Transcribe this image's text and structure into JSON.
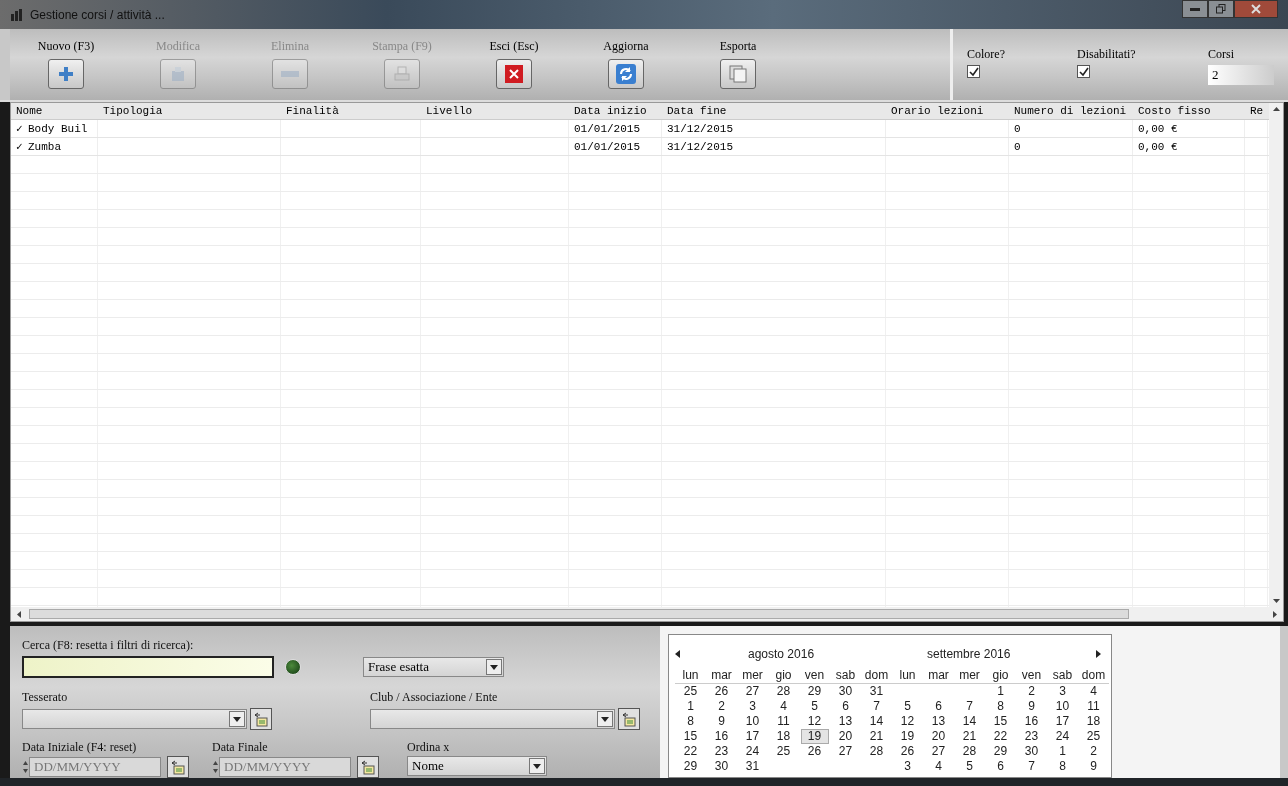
{
  "window": {
    "title": "Gestione corsi / attività ..."
  },
  "toolbar": [
    {
      "label": "Nuovo (F3)",
      "kind": "plus",
      "disabled": false
    },
    {
      "label": "Modifica",
      "kind": "document",
      "disabled": true
    },
    {
      "label": "Elimina",
      "kind": "minus",
      "disabled": true
    },
    {
      "label": "Stampa (F9)",
      "kind": "printer",
      "disabled": true
    },
    {
      "label": "Esci (Esc)",
      "kind": "exit",
      "disabled": false
    },
    {
      "label": "Aggiorna",
      "kind": "refresh",
      "disabled": false
    },
    {
      "label": "Esporta",
      "kind": "copy",
      "disabled": false
    }
  ],
  "options": {
    "color": {
      "label": "Colore?",
      "checked": true
    },
    "disabled": {
      "label": "Disabilitati?",
      "checked": true
    },
    "count": {
      "label": "Corsi",
      "value": "2"
    }
  },
  "table": {
    "columns": [
      "Nome",
      "Tipologia",
      "Finalità",
      "Livello",
      "Data inizio",
      "Data fine",
      "Orario lezioni",
      "Numero di lezioni",
      "Costo fisso",
      "Re"
    ],
    "rows": [
      {
        "checked": true,
        "mark": "✓",
        "name": "Body Buil",
        "start": "01/01/2015",
        "end": "31/12/2015",
        "lessons": "0",
        "cost": "0,00 €"
      },
      {
        "checked": true,
        "mark": "✓",
        "name": "Zumba",
        "start": "01/01/2015",
        "end": "31/12/2015",
        "lessons": "0",
        "cost": "0,00 €"
      }
    ]
  },
  "filters": {
    "search": {
      "label": "Cerca (F8: resetta i filtri di ricerca):"
    },
    "match": {
      "value": "Frase esatta"
    },
    "member": {
      "label": "Tesserato"
    },
    "club": {
      "label": "Club / Associazione / Ente"
    },
    "start_date": {
      "label": "Data Iniziale (F4: reset)",
      "placeholder": "DD/MM/YYYY"
    },
    "end_date": {
      "label": "Data Finale",
      "placeholder": "DD/MM/YYYY"
    },
    "order": {
      "label": "Ordina x",
      "value": "Nome"
    }
  },
  "calendar": {
    "months": [
      {
        "title": "agosto 2016",
        "weekdays": [
          "lun",
          "mar",
          "mer",
          "gio",
          "ven",
          "sab",
          "dom"
        ],
        "weeks": [
          [
            {
              "kind": "day",
              "day": "25",
              "selected": false
            },
            {
              "kind": "day",
              "day": "26",
              "selected": false
            },
            {
              "kind": "day",
              "day": "27",
              "selected": false
            },
            {
              "kind": "day",
              "day": "28",
              "selected": false
            },
            {
              "kind": "day",
              "day": "29",
              "selected": false
            },
            {
              "kind": "day",
              "day": "30",
              "selected": false
            },
            {
              "kind": "day",
              "day": "31",
              "selected": false
            }
          ],
          [
            {
              "kind": "day",
              "day": "1",
              "selected": false
            },
            {
              "kind": "day",
              "day": "2",
              "selected": false
            },
            {
              "kind": "day",
              "day": "3",
              "selected": false
            },
            {
              "kind": "day",
              "day": "4",
              "selected": false
            },
            {
              "kind": "day",
              "day": "5",
              "selected": false
            },
            {
              "kind": "day",
              "day": "6",
              "selected": false
            },
            {
              "kind": "day",
              "day": "7",
              "selected": false
            }
          ],
          [
            {
              "kind": "day",
              "day": "8",
              "selected": false
            },
            {
              "kind": "day",
              "day": "9",
              "selected": false
            },
            {
              "kind": "day",
              "day": "10",
              "selected": false
            },
            {
              "kind": "day",
              "day": "11",
              "selected": false
            },
            {
              "kind": "day",
              "day": "12",
              "selected": false
            },
            {
              "kind": "day",
              "day": "13",
              "selected": false
            },
            {
              "kind": "day",
              "day": "14",
              "selected": false
            }
          ],
          [
            {
              "kind": "day",
              "day": "15",
              "selected": false
            },
            {
              "kind": "day",
              "day": "16",
              "selected": false
            },
            {
              "kind": "day",
              "day": "17",
              "selected": false
            },
            {
              "kind": "day",
              "day": "18",
              "selected": false
            },
            {
              "kind": "day",
              "day": "19",
              "selected": true
            },
            {
              "kind": "day",
              "day": "20",
              "selected": false
            },
            {
              "kind": "day",
              "day": "21",
              "selected": false
            }
          ],
          [
            {
              "kind": "day",
              "day": "22",
              "selected": false
            },
            {
              "kind": "day",
              "day": "23",
              "selected": false
            },
            {
              "kind": "day",
              "day": "24",
              "selected": false
            },
            {
              "kind": "day",
              "day": "25",
              "selected": false
            },
            {
              "kind": "day",
              "day": "26",
              "selected": false
            },
            {
              "kind": "day",
              "day": "27",
              "selected": false
            },
            {
              "kind": "day",
              "day": "28",
              "selected": false
            }
          ],
          [
            {
              "kind": "day",
              "day": "29",
              "selected": false
            },
            {
              "kind": "day",
              "day": "30",
              "selected": false
            },
            {
              "kind": "day",
              "day": "31",
              "selected": false
            },
            {
              "kind": "empty"
            },
            {
              "kind": "empty"
            },
            {
              "kind": "empty"
            },
            {
              "kind": "empty"
            }
          ]
        ]
      },
      {
        "title": "settembre 2016",
        "weekdays": [
          "lun",
          "mar",
          "mer",
          "gio",
          "ven",
          "sab",
          "dom"
        ],
        "weeks": [
          [
            {
              "kind": "empty"
            },
            {
              "kind": "empty"
            },
            {
              "kind": "empty"
            },
            {
              "kind": "day",
              "day": "1",
              "selected": false
            },
            {
              "kind": "day",
              "day": "2",
              "selected": false
            },
            {
              "kind": "day",
              "day": "3",
              "selected": false
            },
            {
              "kind": "day",
              "day": "4",
              "selected": false
            }
          ],
          [
            {
              "kind": "day",
              "day": "5",
              "selected": false
            },
            {
              "kind": "day",
              "day": "6",
              "selected": false
            },
            {
              "kind": "day",
              "day": "7",
              "selected": false
            },
            {
              "kind": "day",
              "day": "8",
              "selected": false
            },
            {
              "kind": "day",
              "day": "9",
              "selected": false
            },
            {
              "kind": "day",
              "day": "10",
              "selected": false
            },
            {
              "kind": "day",
              "day": "11",
              "selected": false
            }
          ],
          [
            {
              "kind": "day",
              "day": "12",
              "selected": false
            },
            {
              "kind": "day",
              "day": "13",
              "selected": false
            },
            {
              "kind": "day",
              "day": "14",
              "selected": false
            },
            {
              "kind": "day",
              "day": "15",
              "selected": false
            },
            {
              "kind": "day",
              "day": "16",
              "selected": false
            },
            {
              "kind": "day",
              "day": "17",
              "selected": false
            },
            {
              "kind": "day",
              "day": "18",
              "selected": false
            }
          ],
          [
            {
              "kind": "day",
              "day": "19",
              "selected": false
            },
            {
              "kind": "day",
              "day": "20",
              "selected": false
            },
            {
              "kind": "day",
              "day": "21",
              "selected": false
            },
            {
              "kind": "day",
              "day": "22",
              "selected": false
            },
            {
              "kind": "day",
              "day": "23",
              "selected": false
            },
            {
              "kind": "day",
              "day": "24",
              "selected": false
            },
            {
              "kind": "day",
              "day": "25",
              "selected": false
            }
          ],
          [
            {
              "kind": "day",
              "day": "26",
              "selected": false
            },
            {
              "kind": "day",
              "day": "27",
              "selected": false
            },
            {
              "kind": "day",
              "day": "28",
              "selected": false
            },
            {
              "kind": "day",
              "day": "29",
              "selected": false
            },
            {
              "kind": "day",
              "day": "30",
              "selected": false
            },
            {
              "kind": "day",
              "day": "1",
              "selected": false
            },
            {
              "kind": "day",
              "day": "2",
              "selected": false
            }
          ],
          [
            {
              "kind": "day",
              "day": "3",
              "selected": false
            },
            {
              "kind": "day",
              "day": "4",
              "selected": false
            },
            {
              "kind": "day",
              "day": "5",
              "selected": false
            },
            {
              "kind": "day",
              "day": "6",
              "selected": false
            },
            {
              "kind": "day",
              "day": "7",
              "selected": false
            },
            {
              "kind": "day",
              "day": "8",
              "selected": false
            },
            {
              "kind": "day",
              "day": "9",
              "selected": false
            }
          ]
        ]
      }
    ]
  }
}
